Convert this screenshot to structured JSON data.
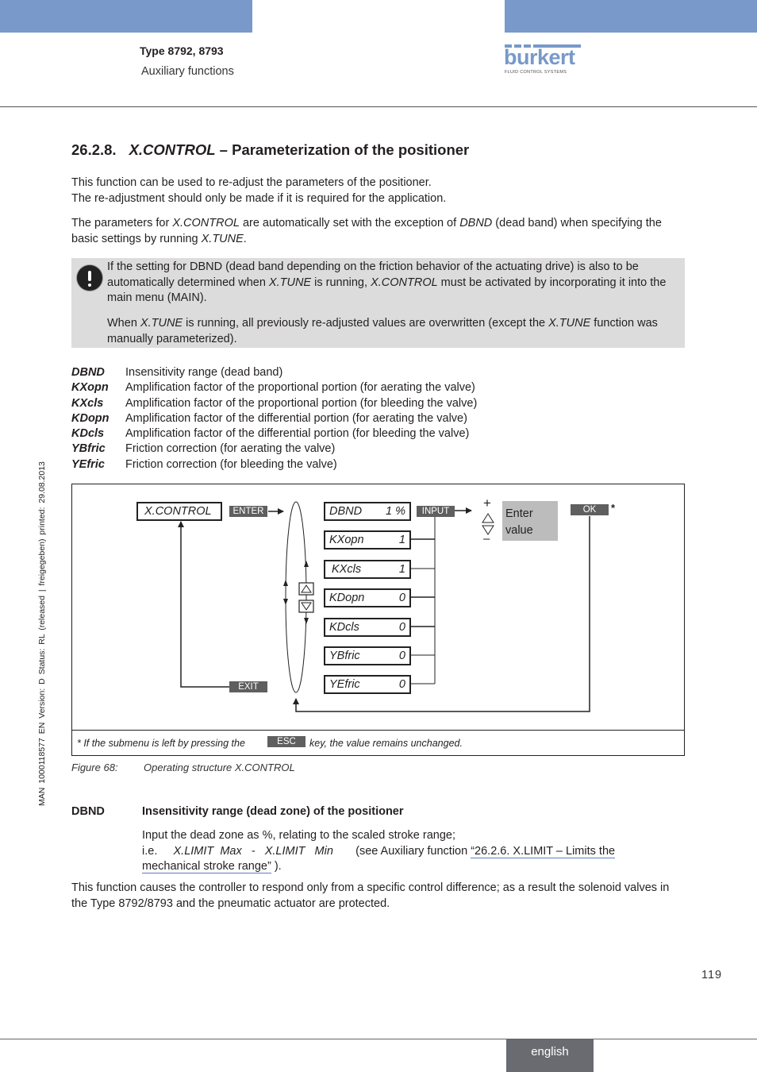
{
  "header": {
    "type": "Type 8792, 8793",
    "section": "Auxiliary functions",
    "brand": {
      "name": "burkert",
      "tagline": "FLUID CONTROL SYSTEMS",
      "color": "#7899c9"
    }
  },
  "side_text": "MAN  1000118577  EN  Version: D  Status: RL (released | freigegeben)  printed: 29.08.2013",
  "heading": {
    "number": "26.2.8.",
    "title_italic": "X.CONTROL",
    "title_rest": " – Parameterization of the positioner"
  },
  "intro": {
    "line1": "This function can be used to re-adjust the parameters of the positioner.",
    "line2": "The re-adjustment should only be made if it is required for the application.",
    "p2_a": "The parameters for ",
    "p2_b": "X.CONTROL",
    "p2_c": " are automatically set with the exception of ",
    "p2_d": "DBND",
    "p2_e": " (dead band) when specifying the basic settings by running ",
    "p2_f": "X.TUNE",
    "p2_g": "."
  },
  "note": {
    "p1_a": "If the setting for DBND (dead band depending on the friction behavior of the actuating drive) is also to be automatically determined when ",
    "p1_b": "X.TUNE",
    "p1_c": " is running, ",
    "p1_d": "X.CONTROL",
    "p1_e": " must be activated by incorporating it into the main menu (MAIN).",
    "p2_a": "When ",
    "p2_b": "X.TUNE",
    "p2_c": " is running, all previously re-adjusted values are overwritten (except the ",
    "p2_d": "X.TUNE",
    "p2_e": " function was manually parameterized)."
  },
  "definitions": [
    {
      "term": "DBND",
      "desc": "Insensitivity range (dead band)"
    },
    {
      "term": "KXopn",
      "desc": "Amplification factor of the proportional portion (for aerating the valve)"
    },
    {
      "term": "KXcls",
      "desc": "Amplification factor of the proportional portion (for bleeding the valve)"
    },
    {
      "term": "KDopn",
      "desc": "Amplification factor of the differential portion (for aerating the valve)"
    },
    {
      "term": "KDcls",
      "desc": "Amplification factor of the differential portion (for bleeding the valve)"
    },
    {
      "term": "YBfric",
      "desc": "Friction correction (for aerating the valve)"
    },
    {
      "term": "YEfric",
      "desc": "Friction correction (for bleeding the valve)"
    }
  ],
  "figure": {
    "menu": "X.CONTROL",
    "keys": {
      "enter": "ENTER",
      "exit": "EXIT",
      "input": "INPUT",
      "ok": "OK",
      "esc": "ESC"
    },
    "params": [
      {
        "name": "DBND",
        "value": "1 %"
      },
      {
        "name": "KXopn",
        "value": "1"
      },
      {
        "name": "KXcls",
        "value": "1"
      },
      {
        "name": "KDopn",
        "value": "0"
      },
      {
        "name": "KDcls",
        "value": "0"
      },
      {
        "name": "YBfric",
        "value": "0"
      },
      {
        "name": "YEfric",
        "value": "0"
      }
    ],
    "plus": "+",
    "minus": "–",
    "enter_value": "Enter value",
    "asterisk": "*",
    "footnote_a": "* If the submenu is left by pressing the",
    "footnote_b": "key, the value remains unchanged.",
    "caption_label": "Figure 68:",
    "caption_text": "Operating structure X.CONTROL"
  },
  "dbnd_section": {
    "term": "DBND",
    "heading": "Insensitivity range (dead zone) of the positioner",
    "line1": "Input the dead zone as %, relating to the scaled stroke range;",
    "ie": "i.e.",
    "formula": "X.LIMIT  Max   -   X.LIMIT   Min",
    "see": "(see Auxiliary function ",
    "link": "“26.2.6. X.LIMIT – Limits the mechanical stroke range”",
    "end": " ).",
    "para": "This function causes the controller to respond only from a specific control difference; as a result the solenoid valves in the Type 8792/8793 and the pneumatic actuator are protected."
  },
  "footer": {
    "page": "119",
    "language": "english"
  }
}
